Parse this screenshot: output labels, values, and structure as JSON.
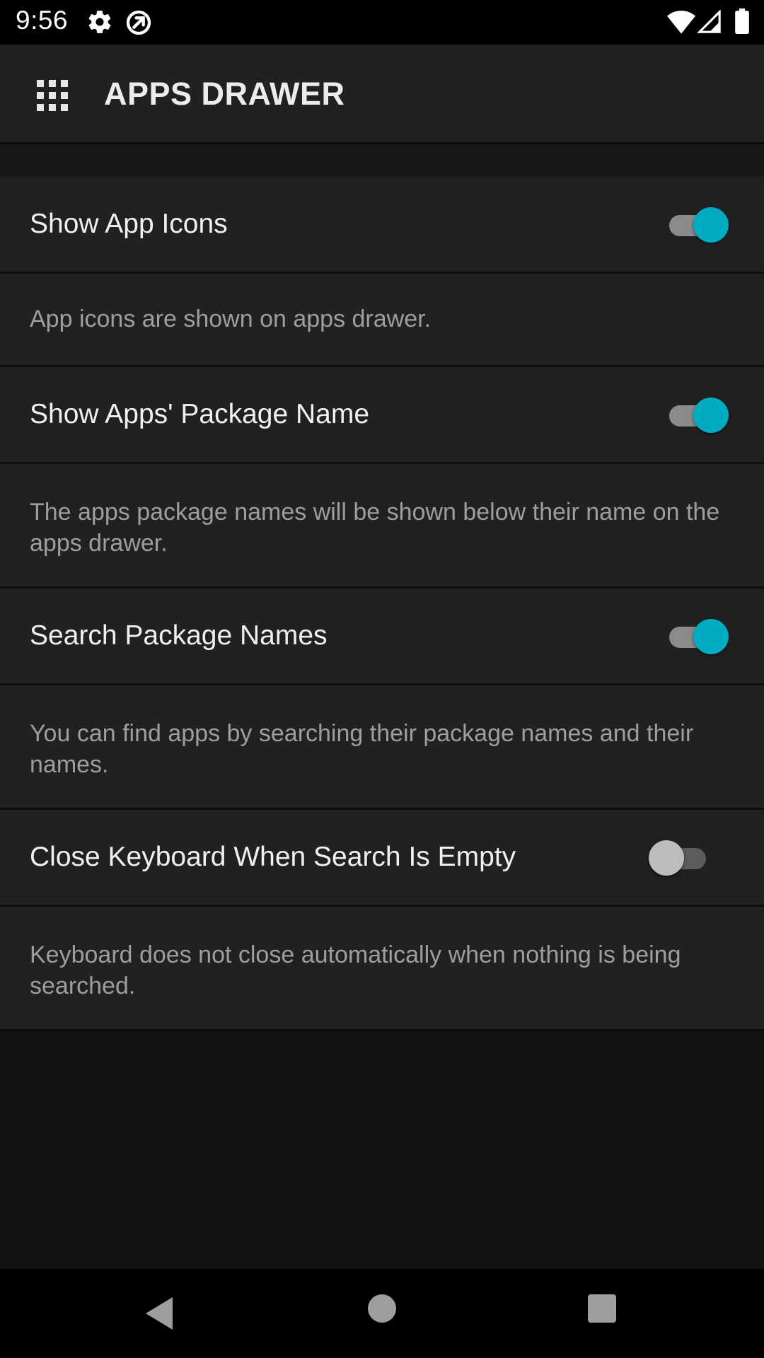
{
  "status_bar": {
    "time": "9:56",
    "icons": [
      "gear-icon",
      "sync-icon",
      "wifi-icon",
      "signal-icon",
      "battery-icon"
    ]
  },
  "app_bar": {
    "icon": "apps-grid-icon",
    "title": "APPS DRAWER"
  },
  "settings": [
    {
      "title": "Show App Icons",
      "enabled": true,
      "description": "App icons are shown on apps drawer."
    },
    {
      "title": "Show Apps' Package Name",
      "enabled": true,
      "description": "The apps package names will be shown below their name on the apps drawer."
    },
    {
      "title": "Search Package Names",
      "enabled": true,
      "description": "You can find apps by searching their package names and their names."
    },
    {
      "title": "Close Keyboard When Search Is Empty",
      "enabled": false,
      "description": "Keyboard does not close automatically when nothing is being searched."
    }
  ],
  "nav_bar": {
    "icons": [
      "back-icon",
      "home-icon",
      "recents-icon"
    ]
  },
  "colors": {
    "accent": "#00acc1",
    "background": "#121212",
    "surface": "#212121",
    "title_text": "#f0f0f0",
    "description_text": "#9e9e9e"
  }
}
